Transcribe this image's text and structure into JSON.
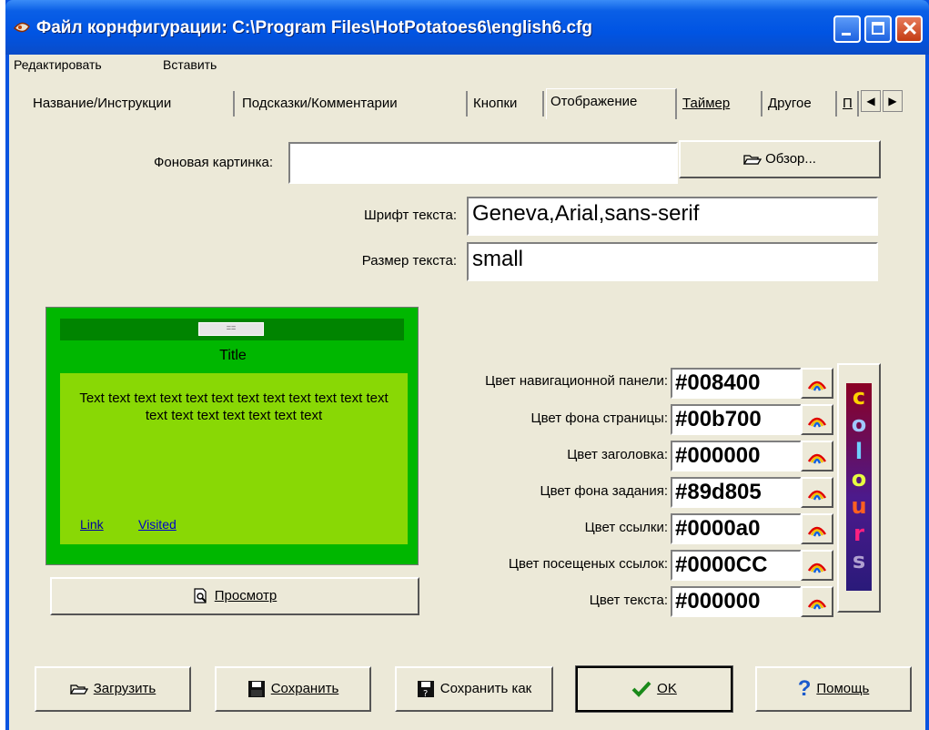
{
  "window": {
    "title": "Файл корнфигурации: C:\\Program Files\\HotPotatoes6\\english6.cfg"
  },
  "menu": {
    "edit": "Редактировать",
    "insert": "Вставить"
  },
  "tabs": [
    {
      "label": "Название/Инструкции"
    },
    {
      "label": "Подсказки/Комментарии"
    },
    {
      "label": "Кнопки"
    },
    {
      "label": "Отображение",
      "active": true
    },
    {
      "label": "Таймер"
    },
    {
      "label": "Другое"
    },
    {
      "label": "П"
    }
  ],
  "display": {
    "background_label": "Фоновая картинка:",
    "background_value": "",
    "browse_label": "Обзор...",
    "font_label": "Шрифт текста:",
    "font_value": "Geneva,Arial,sans-serif",
    "size_label": "Размер текста:",
    "size_value": "small"
  },
  "preview": {
    "nav_button": "==",
    "title": "Title",
    "text": "Text text text text text text text text text text text text text text text text text text text",
    "link": "Link",
    "visited": "Visited",
    "button_label": "Просмотр"
  },
  "colors": [
    {
      "label": "Цвет навигационной панели:",
      "value": "#008400"
    },
    {
      "label": "Цвет фона страницы:",
      "value": "#00b700"
    },
    {
      "label": "Цвет заголовка:",
      "value": "#000000"
    },
    {
      "label": "Цвет фона задания:",
      "value": "#89d805"
    },
    {
      "label": "Цвет ссылки:",
      "value": "#0000a0"
    },
    {
      "label": "Цвет посещеных ссылок:",
      "value": "#0000CC"
    },
    {
      "label": "Цвет текста:",
      "value": "#000000"
    }
  ],
  "colours_logo": [
    "c",
    "o",
    "l",
    "o",
    "u",
    "r",
    "s"
  ],
  "buttons": {
    "load": "Загрузить",
    "save": "Сохранить",
    "save_as": "Сохранить как",
    "ok": "OK",
    "help": "Помощь"
  }
}
